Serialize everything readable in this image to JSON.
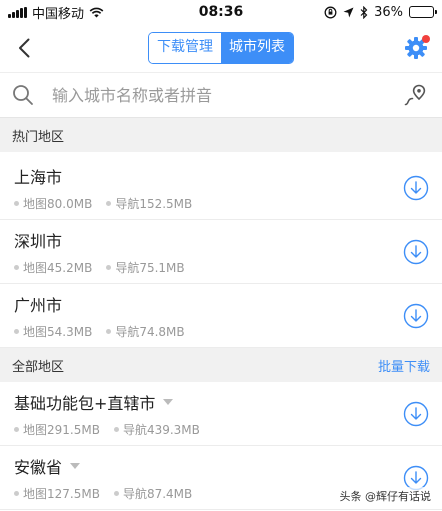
{
  "status_bar": {
    "carrier": "中国移动",
    "time": "08:36",
    "battery": "36%",
    "battery_level": 0.36
  },
  "nav": {
    "tabs": [
      {
        "label": "下载管理",
        "active": false
      },
      {
        "label": "城市列表",
        "active": true
      }
    ]
  },
  "search": {
    "placeholder": "输入城市名称或者拼音"
  },
  "sections": {
    "hot": {
      "title": "热门地区"
    },
    "all": {
      "title": "全部地区",
      "action": "批量下载"
    }
  },
  "hot_cities": [
    {
      "name": "上海市",
      "map": "地图80.0MB",
      "nav": "导航152.5MB"
    },
    {
      "name": "深圳市",
      "map": "地图45.2MB",
      "nav": "导航75.1MB"
    },
    {
      "name": "广州市",
      "map": "地图54.3MB",
      "nav": "导航74.8MB"
    }
  ],
  "all_regions": [
    {
      "name": "基础功能包+直辖市",
      "map": "地图291.5MB",
      "nav": "导航439.3MB",
      "expandable": true
    },
    {
      "name": "安徽省",
      "map": "地图127.5MB",
      "nav": "导航87.4MB",
      "expandable": true
    }
  ],
  "watermark": "头条 @辉仔有话说",
  "colors": {
    "accent": "#3d8ef7",
    "badge": "#f1413d"
  }
}
